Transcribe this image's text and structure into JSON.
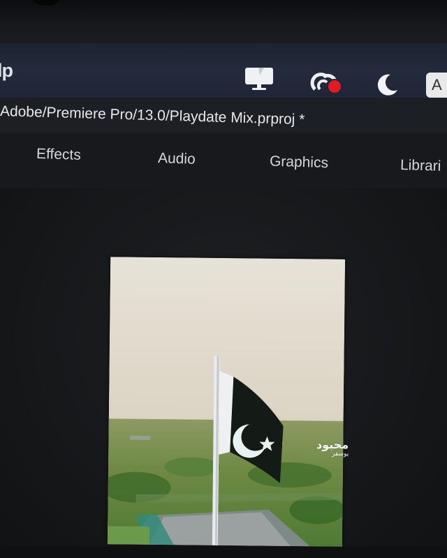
{
  "menubar": {
    "app_name": "lp",
    "tray_icons": [
      "monitor-icon",
      "creative-cloud-icon",
      "moon-icon",
      "input-language-icon"
    ],
    "language_badge": "A",
    "notification_color": "#e01b24"
  },
  "titlebar": {
    "title": "Adobe/Premiere Pro/13.0/Playdate Mix.prproj *"
  },
  "workspace": {
    "tabs": [
      "Effects",
      "Audio",
      "Graphics",
      "Librari"
    ]
  },
  "preview": {
    "subject": "flag-on-pole",
    "watermark_main": "محبود",
    "watermark_sub": "یوسفز"
  }
}
